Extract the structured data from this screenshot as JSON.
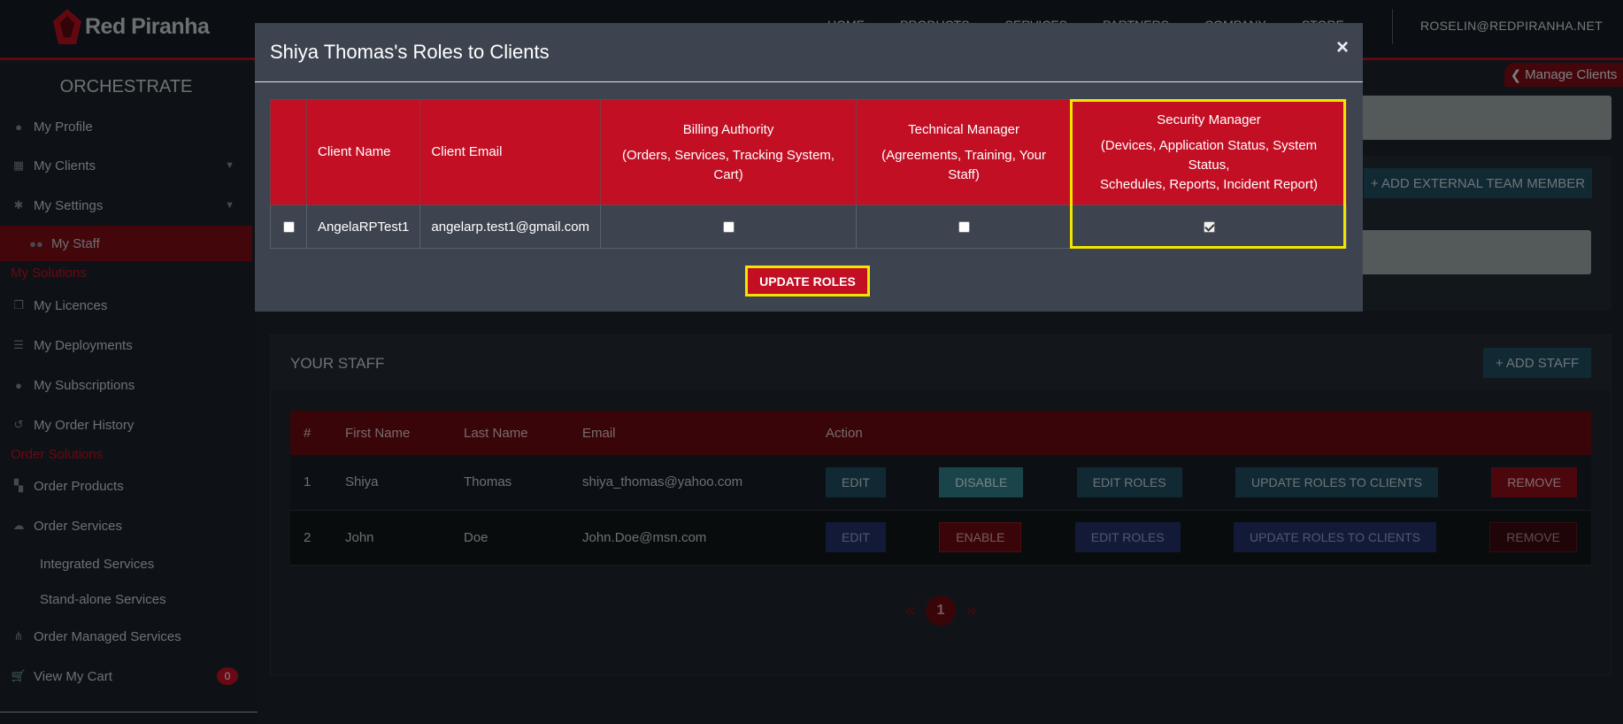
{
  "brand": {
    "name": "Red Piranha"
  },
  "topnav": {
    "items": [
      "HOME",
      "PRODUCTS",
      "SERVICES",
      "PARTNERS",
      "COMPANY",
      "STORE"
    ],
    "user_email": "ROSELIN@REDPIRANHA.NET"
  },
  "sidebar": {
    "title": "ORCHESTRATE",
    "profile": "My Profile",
    "clients": "My Clients",
    "settings": "My Settings",
    "staff": "My Staff",
    "section_solutions": "My Solutions",
    "licences": "My Licences",
    "deployments": "My Deployments",
    "subscriptions": "My Subscriptions",
    "order_history": "My Order History",
    "section_order": "Order Solutions",
    "order_products": "Order Products",
    "order_services": "Order Services",
    "integrated": "Integrated Services",
    "standalone": "Stand-alone Services",
    "managed": "Order Managed Services",
    "cart": "View My Cart",
    "cart_count": "0"
  },
  "background": {
    "manage_clients": "Manage Clients",
    "add_external": "+ ADD EXTERNAL TEAM MEMBER"
  },
  "staff": {
    "title": "YOUR STAFF",
    "add_button": "+ ADD STAFF",
    "headers": [
      "#",
      "First Name",
      "Last Name",
      "Email",
      "Action"
    ],
    "rows": [
      {
        "num": "1",
        "first": "Shiya",
        "last": "Thomas",
        "email": "shiya_thomas@yahoo.com",
        "edit": "EDIT",
        "toggle": "DISABLE",
        "edit_roles": "EDIT ROLES",
        "update_roles": "UPDATE ROLES TO CLIENTS",
        "remove": "REMOVE"
      },
      {
        "num": "2",
        "first": "John",
        "last": "Doe",
        "email": "John.Doe@msn.com",
        "edit": "EDIT",
        "toggle": "ENABLE",
        "edit_roles": "EDIT ROLES",
        "update_roles": "UPDATE ROLES TO CLIENTS",
        "remove": "REMOVE"
      }
    ],
    "pagination": {
      "current": "1",
      "prev": "«",
      "next": "»"
    }
  },
  "modal": {
    "title": "Shiya Thomas's Roles to Clients",
    "close": "×",
    "headers": {
      "client_name": "Client Name",
      "client_email": "Client Email",
      "billing_title": "Billing Authority",
      "billing_desc": "(Orders, Services, Tracking System, Cart)",
      "technical_title": "Technical Manager",
      "technical_desc": "(Agreements, Training, Your Staff)",
      "security_title": "Security Manager",
      "security_desc1": "(Devices, Application Status, System Status,",
      "security_desc2": "Schedules, Reports, Incident Report)"
    },
    "rows": [
      {
        "client_name": "AngelaRPTest1",
        "client_email": "angelarp.test1@gmail.com",
        "selected": false,
        "billing": false,
        "technical": false,
        "security": true
      }
    ],
    "update_button": "UPDATE ROLES"
  }
}
